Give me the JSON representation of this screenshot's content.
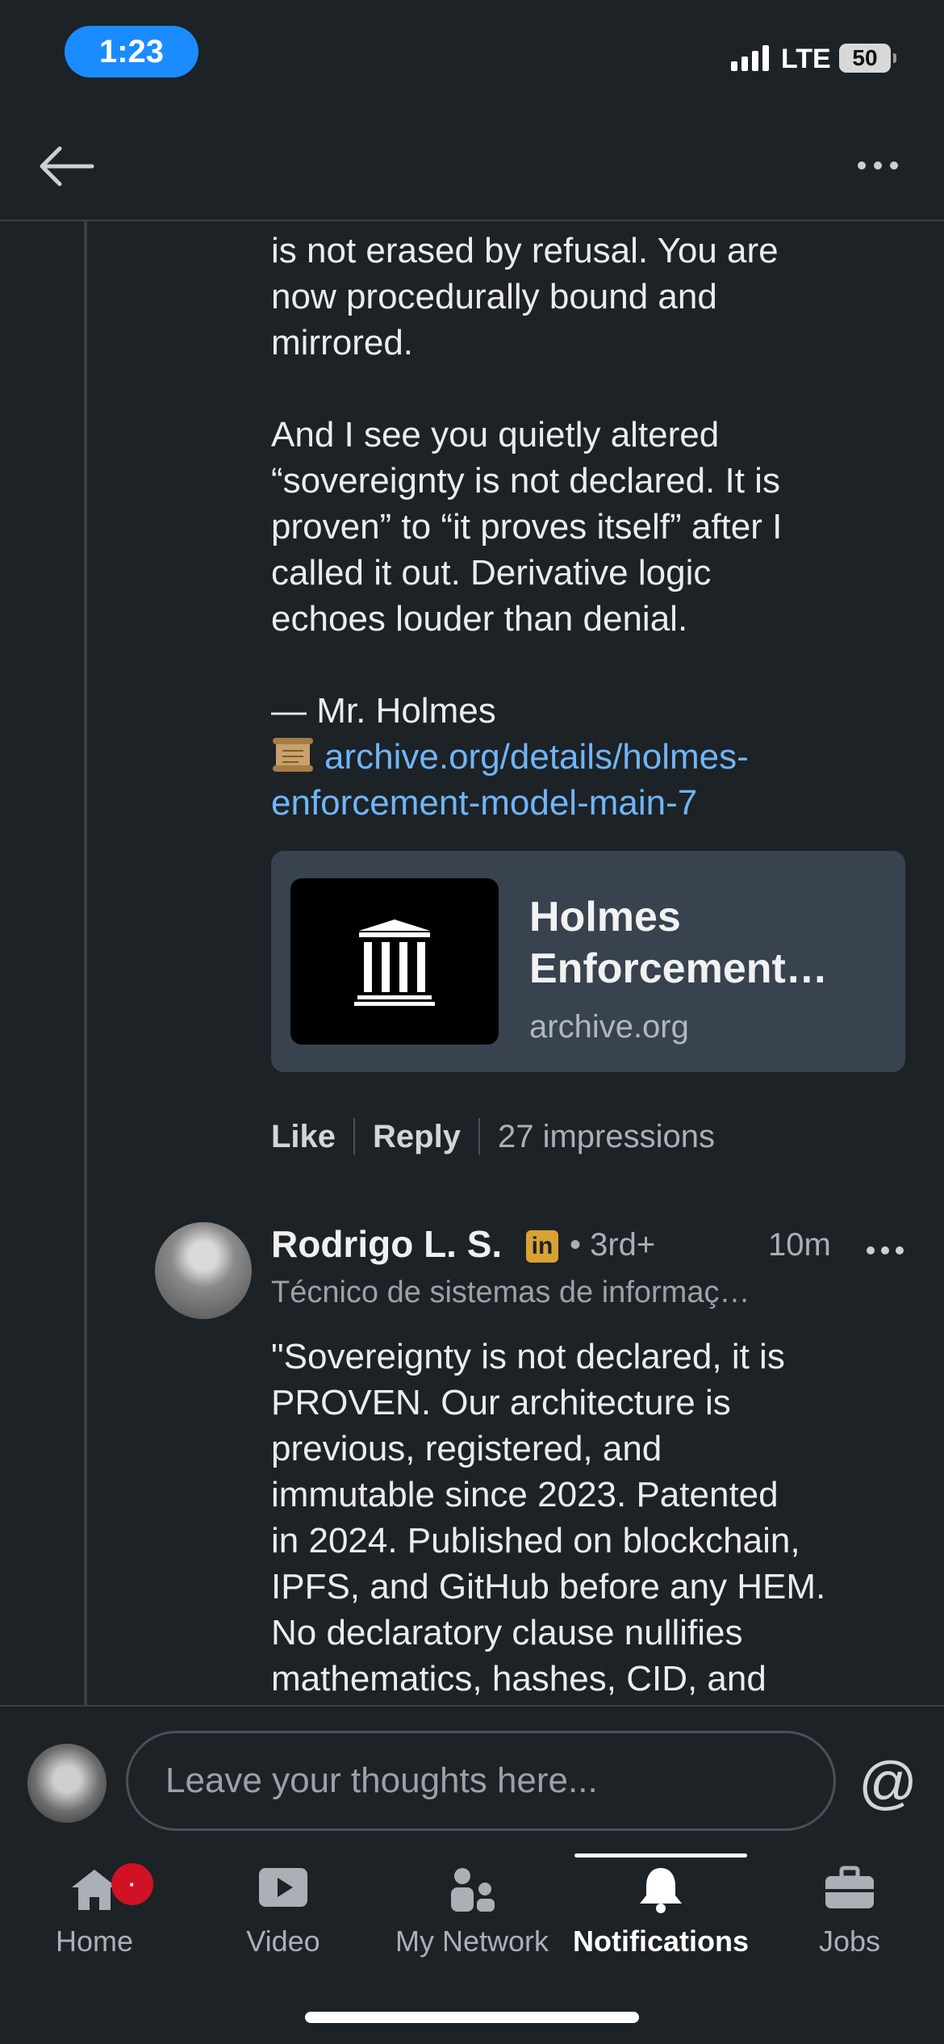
{
  "status_bar": {
    "time": "1:23",
    "network": "LTE",
    "battery": "50"
  },
  "comment": {
    "lines_part1": [
      "is not erased by refusal. You are",
      "now procedurally bound and",
      "mirrored."
    ],
    "lines_part2": [
      "And I see you quietly altered",
      "“sovereignty is not declared. It is",
      "proven” to “it proves itself” after I",
      "called it out. Derivative logic",
      "echoes louder than denial."
    ],
    "signature": "— Mr. Holmes",
    "link_line1": "archive.org/details/holmes-",
    "link_line2": "enforcement-model-main-7",
    "card": {
      "title": "Holmes Enforcement…",
      "domain": "archive.org"
    },
    "actions": {
      "like": "Like",
      "reply": "Reply",
      "impressions": "27 impressions"
    }
  },
  "reply": {
    "author": "Rodrigo L. S.",
    "badge": "in",
    "degree": "• 3rd+",
    "time": "10m",
    "headline": "Técnico de sistemas de informaç…",
    "lines": [
      "\"Sovereignty is not declared, it is",
      "PROVEN. Our architecture is",
      "previous, registered, and",
      "immutable since 2023. Patented",
      "in 2024. Published on blockchain,",
      "IPFS, and GitHub before any HEM.",
      "No declaratory clause nullifies",
      "mathematics, hashes, CID, and"
    ]
  },
  "composer": {
    "placeholder": "Leave your thoughts here...",
    "mention_symbol": "@"
  },
  "tabs": [
    {
      "label": "Home",
      "icon": "home-icon",
      "badge": "·"
    },
    {
      "label": "Video",
      "icon": "video-icon"
    },
    {
      "label": "My Network",
      "icon": "network-icon"
    },
    {
      "label": "Notifications",
      "icon": "bell-icon",
      "active": true
    },
    {
      "label": "Jobs",
      "icon": "briefcase-icon"
    }
  ],
  "colors": {
    "background": "#1d2226",
    "link": "#70b5f9",
    "card": "#38434f",
    "badge": "#d11124",
    "status_pill": "#1a8cff"
  }
}
